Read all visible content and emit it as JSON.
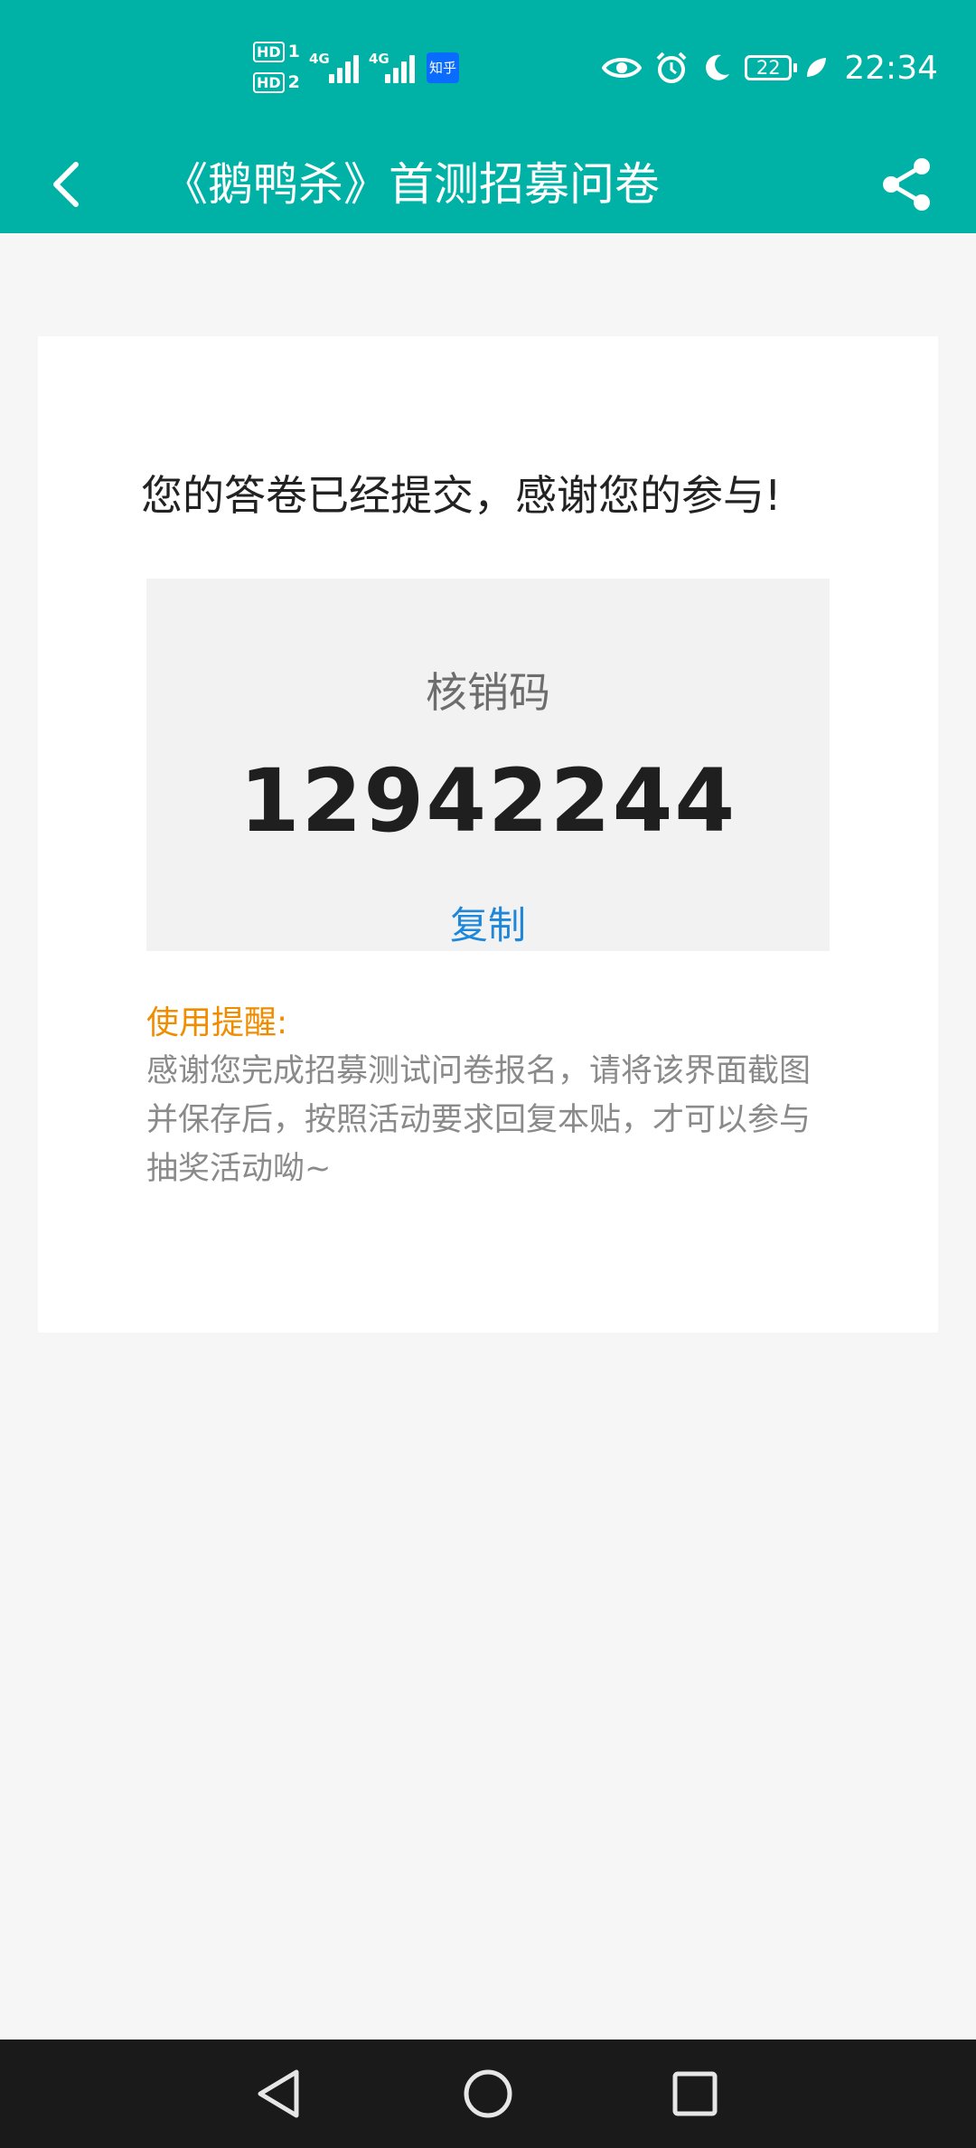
{
  "status_bar": {
    "sim1": "HD",
    "sim1_slot": "1",
    "sim2": "HD",
    "sim2_slot": "2",
    "network1": "4G",
    "network2": "4G",
    "app_badge": "知乎",
    "battery": "22",
    "time": "22:34"
  },
  "app_bar": {
    "title": "《鹅鸭杀》首测招募问卷"
  },
  "content": {
    "success_message": "您的答卷已经提交，感谢您的参与!",
    "code_label": "核销码",
    "code_value": "12942244",
    "copy_label": "复制",
    "tip_title": "使用提醒:",
    "tip_text": "感谢您完成招募测试问卷报名，请将该界面截图并保存后，按照活动要求回复本贴，才可以参与抽奖活动呦~"
  },
  "colors": {
    "header": "#00b2a6",
    "accent_blue": "#1e87d9",
    "tip_orange": "#f08c00",
    "background": "#f6f6f6"
  }
}
